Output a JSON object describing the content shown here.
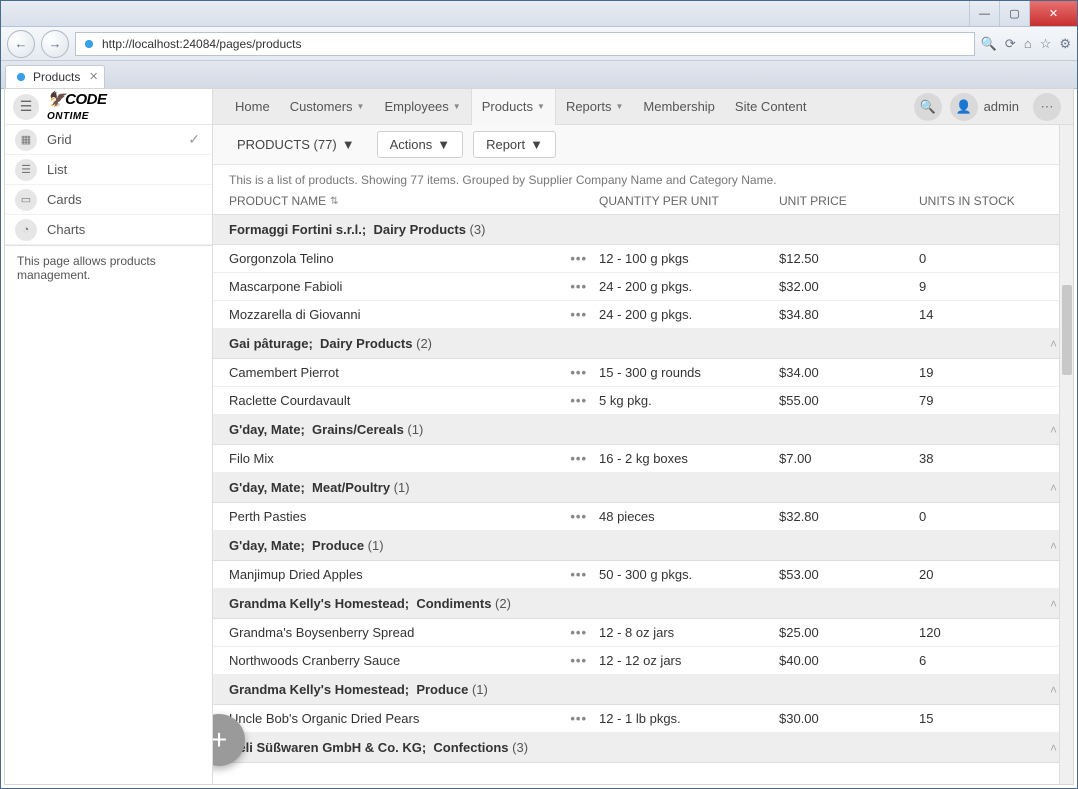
{
  "browser": {
    "url": "http://localhost:24084/pages/products",
    "tab_title": "Products"
  },
  "sidebar": {
    "items": [
      {
        "label": "Grid",
        "active": true
      },
      {
        "label": "List"
      },
      {
        "label": "Cards"
      },
      {
        "label": "Charts"
      }
    ],
    "description": "This page allows products management."
  },
  "topnav": {
    "items": [
      "Home",
      "Customers",
      "Employees",
      "Products",
      "Reports",
      "Membership",
      "Site Content"
    ],
    "user": "admin"
  },
  "toolbar": {
    "title": "PRODUCTS (77)",
    "actions": "Actions",
    "report": "Report"
  },
  "grid": {
    "description": "This is a list of products. Showing 77 items. Grouped by Supplier Company Name and Category Name.",
    "columns": {
      "name": "PRODUCT NAME",
      "qty": "QUANTITY PER UNIT",
      "price": "UNIT PRICE",
      "stock": "UNITS IN STOCK"
    },
    "groups": [
      {
        "supplier": "Formaggi Fortini s.r.l.;",
        "category": "Dairy Products",
        "count": "(3)",
        "collapsible": false,
        "rows": [
          {
            "name": "Gorgonzola Telino",
            "qty": "12 - 100 g pkgs",
            "price": "$12.50",
            "stock": "0"
          },
          {
            "name": "Mascarpone Fabioli",
            "qty": "24 - 200 g pkgs.",
            "price": "$32.00",
            "stock": "9"
          },
          {
            "name": "Mozzarella di Giovanni",
            "qty": "24 - 200 g pkgs.",
            "price": "$34.80",
            "stock": "14"
          }
        ]
      },
      {
        "supplier": "Gai pâturage;",
        "category": "Dairy Products",
        "count": "(2)",
        "collapsible": true,
        "rows": [
          {
            "name": "Camembert Pierrot",
            "qty": "15 - 300 g rounds",
            "price": "$34.00",
            "stock": "19"
          },
          {
            "name": "Raclette Courdavault",
            "qty": "5 kg pkg.",
            "price": "$55.00",
            "stock": "79"
          }
        ]
      },
      {
        "supplier": "G'day, Mate;",
        "category": "Grains/Cereals",
        "count": "(1)",
        "collapsible": true,
        "rows": [
          {
            "name": "Filo Mix",
            "qty": "16 - 2 kg boxes",
            "price": "$7.00",
            "stock": "38"
          }
        ]
      },
      {
        "supplier": "G'day, Mate;",
        "category": "Meat/Poultry",
        "count": "(1)",
        "collapsible": true,
        "rows": [
          {
            "name": "Perth Pasties",
            "qty": "48 pieces",
            "price": "$32.80",
            "stock": "0"
          }
        ]
      },
      {
        "supplier": "G'day, Mate;",
        "category": "Produce",
        "count": "(1)",
        "collapsible": true,
        "rows": [
          {
            "name": "Manjimup Dried Apples",
            "qty": "50 - 300 g pkgs.",
            "price": "$53.00",
            "stock": "20"
          }
        ]
      },
      {
        "supplier": "Grandma Kelly's Homestead;",
        "category": "Condiments",
        "count": "(2)",
        "collapsible": true,
        "rows": [
          {
            "name": "Grandma's Boysenberry Spread",
            "qty": "12 - 8 oz jars",
            "price": "$25.00",
            "stock": "120"
          },
          {
            "name": "Northwoods Cranberry Sauce",
            "qty": "12 - 12 oz jars",
            "price": "$40.00",
            "stock": "6"
          }
        ]
      },
      {
        "supplier": "Grandma Kelly's Homestead;",
        "category": "Produce",
        "count": "(1)",
        "collapsible": true,
        "rows": [
          {
            "name": "Uncle Bob's Organic Dried Pears",
            "qty": "12 - 1 lb pkgs.",
            "price": "$30.00",
            "stock": "15"
          }
        ]
      },
      {
        "supplier": "Heli Süßwaren GmbH & Co. KG;",
        "category": "Confections",
        "count": "(3)",
        "collapsible": true,
        "rows": []
      }
    ]
  }
}
